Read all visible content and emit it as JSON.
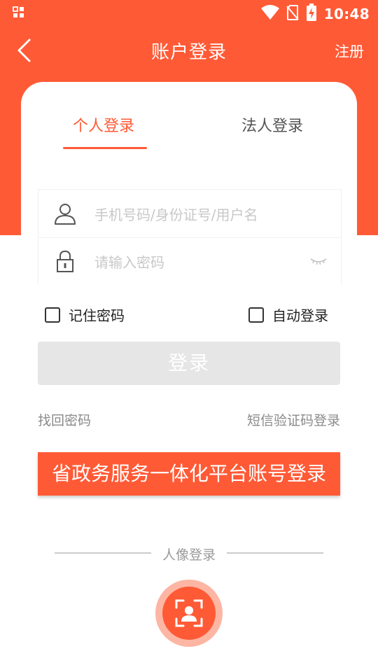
{
  "status_bar": {
    "time": "10:48"
  },
  "header": {
    "title": "账户登录",
    "register_label": "注册"
  },
  "tabs": [
    {
      "label": "个人登录",
      "active": true
    },
    {
      "label": "法人登录",
      "active": false
    }
  ],
  "form": {
    "username_placeholder": "手机号码/身份证号/用户名",
    "password_placeholder": "请输入密码"
  },
  "options": {
    "remember_label": "记住密码",
    "auto_login_label": "自动登录"
  },
  "login_button": "登录",
  "links": {
    "forgot": "找回密码",
    "sms_login": "短信验证码登录"
  },
  "gov_login_button": "省政务服务一体化平台账号登录",
  "face_login": {
    "label": "人像登录"
  },
  "colors": {
    "accent": "#FF5A36",
    "disabled_button": "#E6E6E6"
  }
}
